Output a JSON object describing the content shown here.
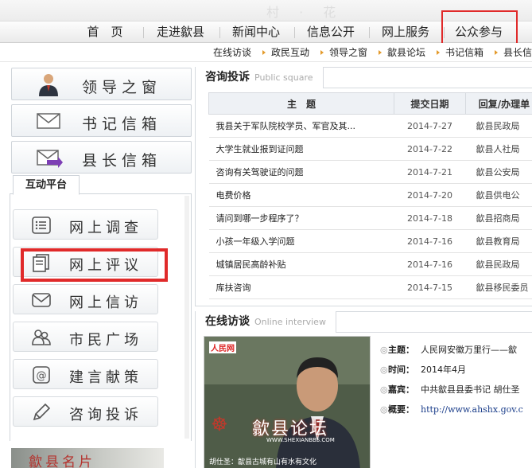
{
  "main_nav": {
    "items": [
      "首　页",
      "走进歙县",
      "新闻中心",
      "信息公开",
      "网上服务",
      "公众参与"
    ]
  },
  "sub_nav": {
    "items": [
      "在线访谈",
      "政民互动",
      "领导之窗",
      "歙县论坛",
      "书记信箱",
      "县长信"
    ]
  },
  "left": {
    "top_buttons": [
      {
        "label": "领导之窗",
        "icon": "leader-icon"
      },
      {
        "label": "书记信箱",
        "icon": "envelope-icon"
      },
      {
        "label": "县长信箱",
        "icon": "envelope-send-icon"
      }
    ],
    "tab_label": "互动平台",
    "interact_buttons": [
      {
        "label": "网上调查",
        "icon": "list-icon"
      },
      {
        "label": "网上评议",
        "icon": "document-icon"
      },
      {
        "label": "网上信访",
        "icon": "mail-icon"
      },
      {
        "label": "市民广场",
        "icon": "people-icon"
      },
      {
        "label": "建言献策",
        "icon": "at-icon"
      },
      {
        "label": "咨询投诉",
        "icon": "pen-icon"
      }
    ],
    "bottom_banner": "歙县名片"
  },
  "consult": {
    "title": "咨询投诉",
    "title_en": "Public square",
    "columns": [
      "主　题",
      "提交日期",
      "回复/办理单"
    ],
    "rows": [
      {
        "subject": "我县关于军队院校学员、军官及其...",
        "date": "2014-7-27",
        "dept": "歙县民政局"
      },
      {
        "subject": "大学生就业报到证问题",
        "date": "2014-7-22",
        "dept": "歙县人社局"
      },
      {
        "subject": "咨询有关驾驶证的问题",
        "date": "2014-7-21",
        "dept": "歙县公安局"
      },
      {
        "subject": "电费价格",
        "date": "2014-7-20",
        "dept": "歙县供电公"
      },
      {
        "subject": "请问到哪一步程序了？",
        "date": "2014-7-18",
        "dept": "歙县招商局"
      },
      {
        "subject": "小孩一年级入学问题",
        "date": "2014-7-16",
        "dept": "歙县教育局"
      },
      {
        "subject": "城镇居民高龄补贴",
        "date": "2014-7-16",
        "dept": "歙县民政局"
      },
      {
        "subject": "库扶咨询",
        "date": "2014-7-15",
        "dept": "歙县移民委员"
      }
    ]
  },
  "interview": {
    "title": "在线访谈",
    "title_en": "Online interview",
    "video_logo": "人民网",
    "video_overlay": "歙县论坛",
    "video_url": "WWW.SHEXIANBBS.COM",
    "video_caption": "胡仕圣：歙县古城有山有水有文化",
    "fields": [
      {
        "label": "主题：",
        "value": "人民网安徽万里行——歙"
      },
      {
        "label": "时间：",
        "value": "2014年4月"
      },
      {
        "label": "嘉宾：",
        "value": "中共歙县县委书记  胡仕圣"
      },
      {
        "label": "概要：",
        "value": "http://www.ahshx.gov.c"
      }
    ]
  },
  "colors": {
    "highlight": "#e02a2a",
    "accent_arrow": "#e39a2a",
    "link": "#1a3d8a"
  }
}
